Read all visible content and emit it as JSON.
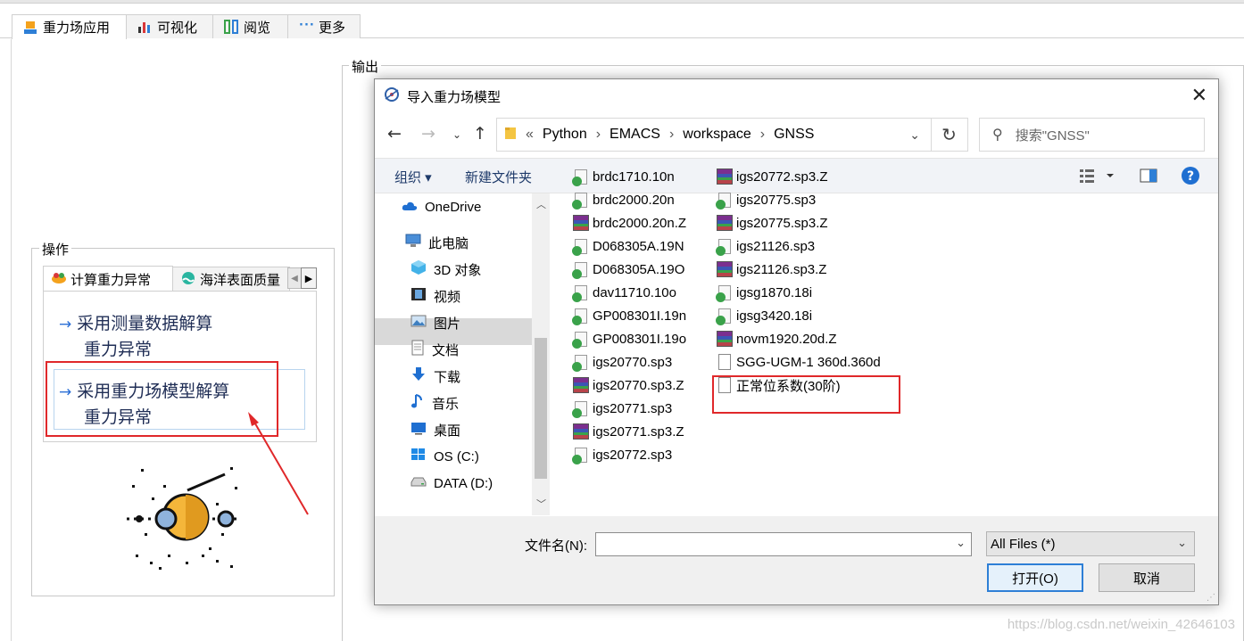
{
  "ribbon": {
    "tabs": [
      {
        "label": "重力场应用",
        "icon": "gravity-app-icon"
      },
      {
        "label": "可视化",
        "icon": "bar-chart-icon"
      },
      {
        "label": "阅览",
        "icon": "browse-icon"
      },
      {
        "label": "更多",
        "icon": "more-dots-icon"
      }
    ]
  },
  "output_panel": {
    "legend": "输出"
  },
  "operations": {
    "legend": "操作",
    "tabs": [
      "计算重力异常",
      "海洋表面质量"
    ],
    "items": [
      {
        "line1": "采用测量数据解算",
        "line2": "重力异常"
      },
      {
        "line1": "采用重力场模型解算",
        "line2": "重力异常"
      }
    ]
  },
  "dialog": {
    "title": "导入重力场模型",
    "breadcrumb_prefix": "«",
    "breadcrumb": [
      "Python",
      "EMACS",
      "workspace",
      "GNSS"
    ],
    "search_placeholder": "搜索\"GNSS\"",
    "organize_label": "组织 ▾",
    "new_folder_label": "新建文件夹",
    "nav_items": [
      {
        "label": "OneDrive",
        "icon": "cloud-icon"
      },
      {
        "label": "此电脑",
        "icon": "computer-icon"
      },
      {
        "label": "3D 对象",
        "icon": "cube-icon"
      },
      {
        "label": "视频",
        "icon": "video-icon"
      },
      {
        "label": "图片",
        "icon": "picture-icon"
      },
      {
        "label": "文档",
        "icon": "document-icon"
      },
      {
        "label": "下载",
        "icon": "download-icon"
      },
      {
        "label": "音乐",
        "icon": "music-icon"
      },
      {
        "label": "桌面",
        "icon": "desktop-icon"
      },
      {
        "label": "OS (C:)",
        "icon": "windows-drive-icon"
      },
      {
        "label": "DATA (D:)",
        "icon": "drive-icon"
      }
    ],
    "files_col1": [
      {
        "name": "brdc1710.10n",
        "type": "check"
      },
      {
        "name": "brdc2000.20n",
        "type": "check"
      },
      {
        "name": "brdc2000.20n.Z",
        "type": "zip"
      },
      {
        "name": "D068305A.19N",
        "type": "check"
      },
      {
        "name": "D068305A.19O",
        "type": "check"
      },
      {
        "name": "dav11710.10o",
        "type": "check"
      },
      {
        "name": "GP008301I.19n",
        "type": "check"
      },
      {
        "name": "GP008301I.19o",
        "type": "check"
      },
      {
        "name": "igs20770.sp3",
        "type": "check"
      },
      {
        "name": "igs20770.sp3.Z",
        "type": "zip"
      },
      {
        "name": "igs20771.sp3",
        "type": "check"
      },
      {
        "name": "igs20771.sp3.Z",
        "type": "zip"
      },
      {
        "name": "igs20772.sp3",
        "type": "check"
      }
    ],
    "files_col2": [
      {
        "name": "igs20772.sp3.Z",
        "type": "zip"
      },
      {
        "name": "igs20775.sp3",
        "type": "check"
      },
      {
        "name": "igs20775.sp3.Z",
        "type": "zip"
      },
      {
        "name": "igs21126.sp3",
        "type": "check"
      },
      {
        "name": "igs21126.sp3.Z",
        "type": "zip"
      },
      {
        "name": "igsg1870.18i",
        "type": "check"
      },
      {
        "name": "igsg3420.18i",
        "type": "check"
      },
      {
        "name": "novm1920.20d.Z",
        "type": "zip"
      },
      {
        "name": "SGG-UGM-1  360d.360d",
        "type": "doc"
      },
      {
        "name": "正常位系数(30阶)",
        "type": "doc"
      }
    ],
    "filename_label": "文件名(N):",
    "filename_value": "",
    "filetype_value": "All Files (*)",
    "open_label": "打开(O)",
    "cancel_label": "取消"
  },
  "watermark": "https://blog.csdn.net/weixin_42646103",
  "colors": {
    "highlight": "#e0282a",
    "accent": "#2e7fd6"
  }
}
